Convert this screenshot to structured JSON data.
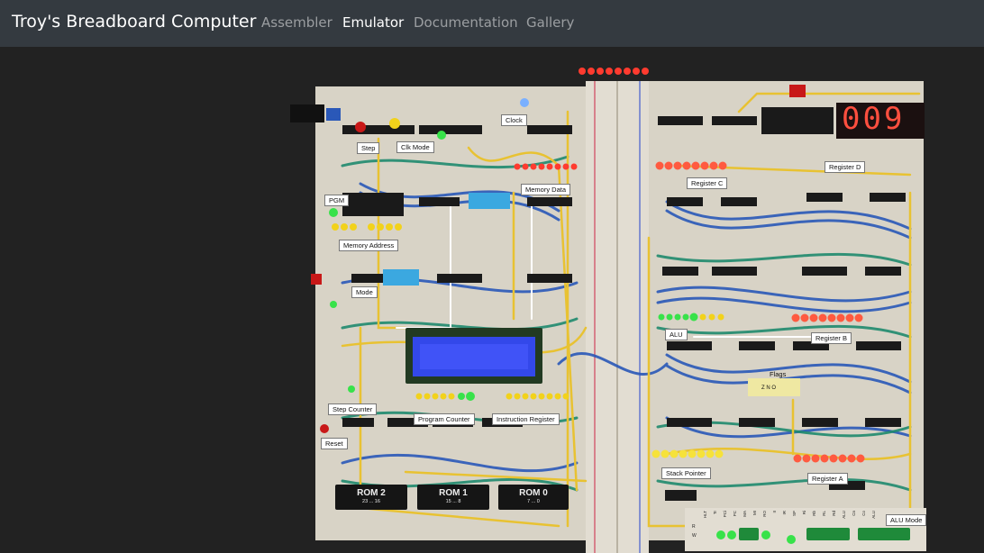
{
  "nav": {
    "brand": "Troy's Breadboard Computer",
    "links": [
      {
        "label": "Assembler",
        "active": false
      },
      {
        "label": "Emulator",
        "active": true
      },
      {
        "label": "Documentation",
        "active": false
      },
      {
        "label": "Gallery",
        "active": false
      }
    ]
  },
  "board": {
    "display_value": "009",
    "labels": {
      "clock": "Clock",
      "step": "Step",
      "clk_mode": "Clk Mode",
      "memory_data": "Memory Data",
      "register_c": "Register C",
      "register_d": "Register D",
      "pgm": "PGM",
      "memory_address": "Memory Address",
      "mode": "Mode",
      "alu": "ALU",
      "register_b": "Register B",
      "flags": "Flags",
      "flag_bits": "Z N O",
      "step_counter": "Step Counter",
      "program_counter": "Program Counter",
      "instruction_register": "Instruction Register",
      "reset": "Reset",
      "stack_pointer": "Stack Pointer",
      "register_a": "Register A",
      "alu_mode": "ALU Mode"
    },
    "roms": [
      {
        "name": "ROM 2",
        "range": "23 ... 16"
      },
      {
        "name": "ROM 1",
        "range": "15 ... 8"
      },
      {
        "name": "ROM 0",
        "range": "7 ... 0"
      }
    ],
    "control_labels": [
      "HLT",
      "Tr",
      "PCi",
      "PC",
      "MA",
      "MI",
      "RO",
      "II",
      "IR",
      "SP",
      "Ri",
      "Rb",
      "RL",
      "Rd",
      "ALU",
      "Cn",
      "Co",
      "ALU"
    ],
    "control_rows": [
      "R",
      "W"
    ]
  },
  "colors": {
    "navbar_bg": "#343a40",
    "page_bg": "#222222",
    "led_red": "#ff3b2f",
    "led_green": "#38e24a",
    "led_yellow": "#f2d21b",
    "wire_blue": "#2a58b8",
    "wire_green": "#1f8a6e",
    "wire_yellow": "#e8c232",
    "lcd_blue": "#3348ea"
  }
}
